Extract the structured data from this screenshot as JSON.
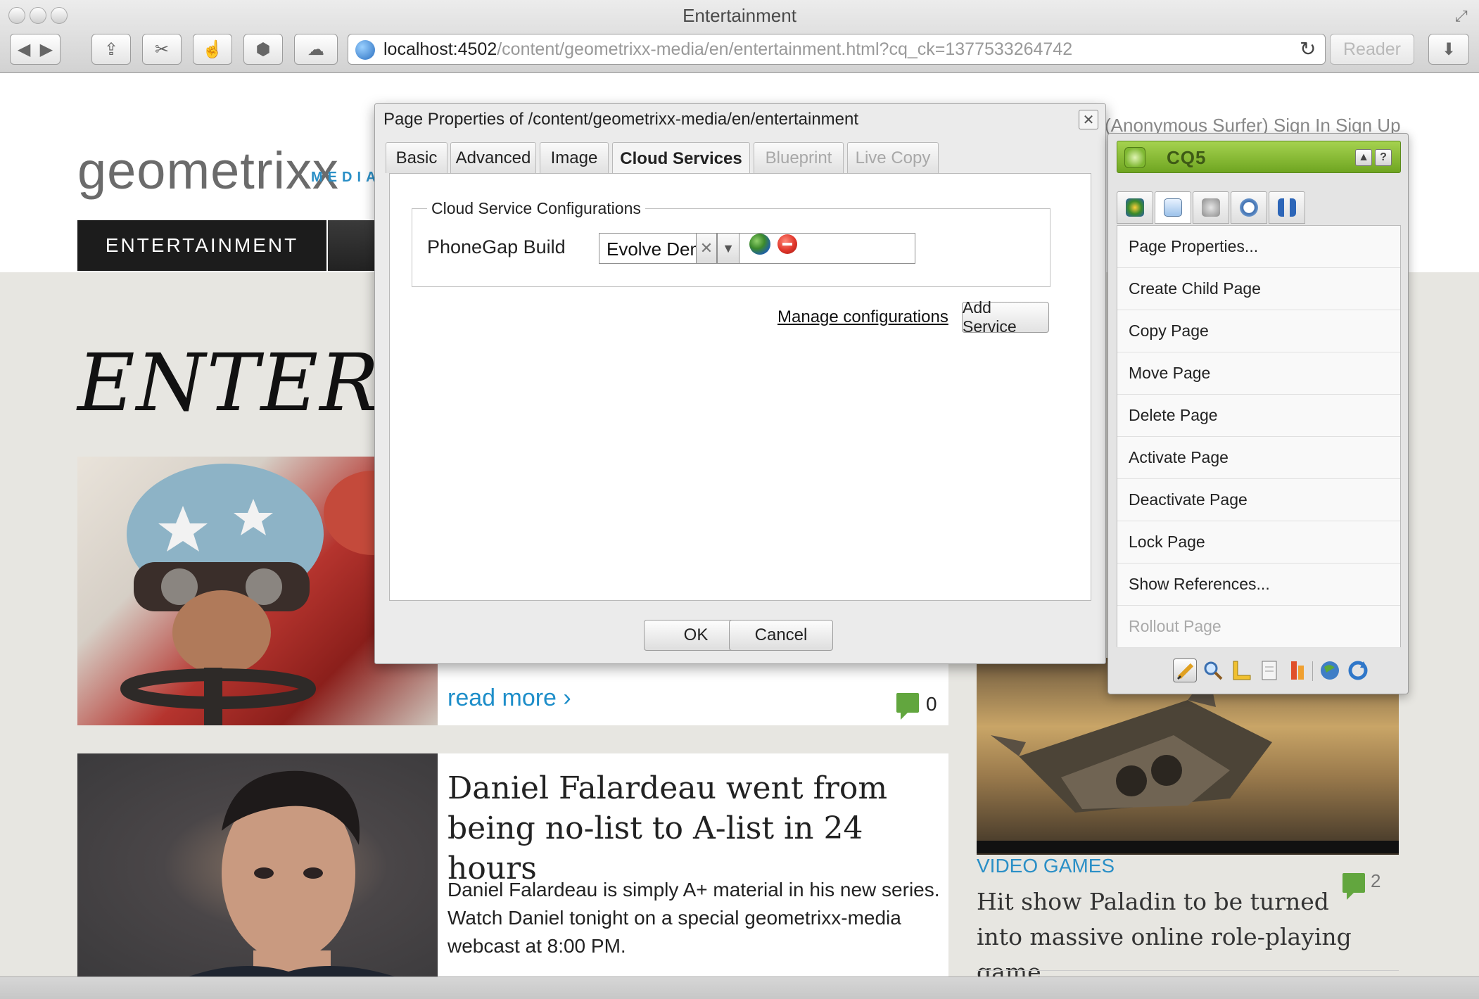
{
  "browser": {
    "window_title": "Entertainment",
    "url_host": "localhost:4502",
    "url_path": "/content/geometrixx-media/en/entertainment.html?cq_ck=1377533264742",
    "reader_label": "Reader"
  },
  "site": {
    "logo_text": "geometrixx",
    "logo_sub": "MEDIA",
    "user_links": "(Anonymous Surfer)   Sign In   Sign Up",
    "nav_active": "ENTERTAINMENT",
    "page_headline": "ENTERTAINMENT",
    "card1": {
      "read_more": "read more ›",
      "comment_count": "0"
    },
    "card2": {
      "title": "Daniel Falardeau went from being no-list to A-list in 24 hours",
      "body": "Daniel Falardeau is simply A+ material in his new series. Watch Daniel tonight on a special geometrixx-media webcast at 8:00 PM."
    },
    "right_card": {
      "category": "VIDEO GAMES",
      "title": "Hit show Paladin to be turned into massive online role-playing game",
      "comment_count": "2"
    }
  },
  "dialog": {
    "title": "Page Properties of /content/geometrixx-media/en/entertainment",
    "tabs": [
      "Basic",
      "Advanced",
      "Image",
      "Cloud Services",
      "Blueprint",
      "Live Copy"
    ],
    "active_tab": "Cloud Services",
    "fieldset_legend": "Cloud Service Configurations",
    "service_label": "PhoneGap Build",
    "service_value": "Evolve Demo",
    "manage_link": "Manage configurations",
    "add_service": "Add Service",
    "ok": "OK",
    "cancel": "Cancel"
  },
  "sidekick": {
    "title": "CQ5",
    "menu": [
      "Page Properties...",
      "Create Child Page",
      "Copy Page",
      "Move Page",
      "Delete Page",
      "Activate Page",
      "Deactivate Page",
      "Lock Page",
      "Show References...",
      "Rollout Page"
    ],
    "disabled_item": "Rollout Page"
  },
  "colors": {
    "accent_blue": "#1e8ec9",
    "sidekick_green": "#8cc03a",
    "comment_green": "#62a63e"
  }
}
